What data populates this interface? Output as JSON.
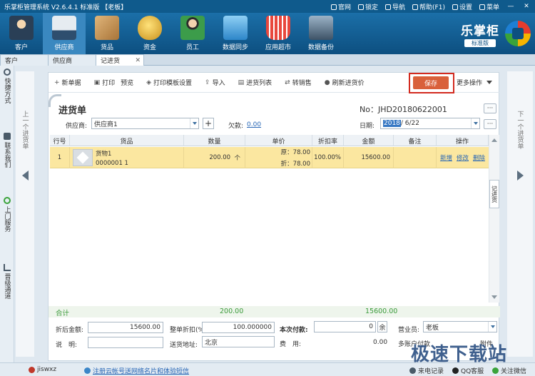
{
  "titlebar": {
    "title": "乐掌柜管理系统 V2.6.4.1 标准版 【老板】",
    "links": [
      "官网",
      "锁定",
      "导航",
      "帮助(F1)",
      "设置",
      "菜单"
    ],
    "window_buttons": [
      "—",
      "✕"
    ]
  },
  "toolbar": {
    "buttons": [
      {
        "label": "客户",
        "icon": "customer-icon",
        "color": "#e0a23a"
      },
      {
        "label": "供应商",
        "icon": "supplier-truck-icon",
        "color": "#c9d3dc"
      },
      {
        "label": "货品",
        "icon": "goods-box-icon",
        "color": "#c79a5a"
      },
      {
        "label": "资金",
        "icon": "money-bag-icon",
        "color": "#e2b23c"
      },
      {
        "label": "员工",
        "icon": "employee-icon",
        "color": "#3c9c4a"
      },
      {
        "label": "数据同步",
        "icon": "sync-icon",
        "color": "#58a7e0"
      },
      {
        "label": "应用超市",
        "icon": "app-market-icon",
        "color": "#d8423a"
      },
      {
        "label": "数据备份",
        "icon": "backup-icon",
        "color": "#6c7f92"
      }
    ],
    "brand_name": "乐掌柜",
    "brand_edition": "标准版"
  },
  "tabs": [
    {
      "label": "客户",
      "active": false
    },
    {
      "label": "供应商",
      "active": false
    },
    {
      "label": "记进货",
      "active": true,
      "close": "✕"
    }
  ],
  "left_sidebar": [
    {
      "label": "快捷方式",
      "icon": "quick-icon"
    },
    {
      "label": "联系我们",
      "icon": "phone-icon"
    },
    {
      "label": "上门服务",
      "icon": "bike-icon"
    },
    {
      "label": "晋级通道",
      "icon": "upgrade-icon"
    }
  ],
  "nav": {
    "prev": "上一个进货单",
    "next": "下一个进货单"
  },
  "actions": {
    "items": [
      "新单据",
      "打印",
      "预览",
      "打印模板设置",
      "导入",
      "进货列表",
      "转销售",
      "刷新进货价"
    ],
    "save": "保存",
    "more": "更多操作"
  },
  "doc": {
    "title": "进货单",
    "number": "No：JHD20180622001",
    "supplier_label": "供应商:",
    "supplier_value": "供应商1",
    "plus": "+",
    "owed_label": "欠款:",
    "owed_value": "0.00",
    "date_label": "日期:",
    "date_year": "2018",
    "date_rest": "/ 6/22",
    "more_dots": "···"
  },
  "grid": {
    "headers": [
      "行号",
      "货品",
      "数量",
      "单价",
      "折扣率",
      "金额",
      "备注",
      "操作"
    ],
    "rows": [
      {
        "no": "1",
        "goods_name": "货物1",
        "goods_code": "0000001 1",
        "qty": "200.00",
        "unit": "个",
        "price_orig": "原：78.00",
        "price_disc": "折：78.00",
        "discount": "100.00%",
        "amount": "15600.00",
        "remark": "",
        "ops": [
          "新增",
          "修改",
          "删除"
        ]
      }
    ],
    "side_handle": "记进货"
  },
  "totals": {
    "label": "合计",
    "qty": "200.00",
    "amount": "15600.00"
  },
  "form": {
    "after_disc_label": "折后金额:",
    "after_disc_value": "15600.00",
    "whole_disc_label": "整单折扣(%)",
    "whole_disc_value": "100.000000",
    "pay_label": "本次付款:",
    "pay_value": "0",
    "pay_suffix": "余",
    "seller_label": "营业员:",
    "seller_value": "老板",
    "note_label": "说　明:",
    "note_value": "",
    "address_label": "送货地址:",
    "address_value": "北京",
    "fee_label": "费　用:",
    "fee_value": "0.00",
    "multi_pay": "多账户付款",
    "attach": "附件"
  },
  "footer": {
    "user": "jiswxz",
    "register_link": "注册云帐号送网络名片和体验短信",
    "right": [
      "来电记录",
      "QQ客服",
      "关注微信"
    ]
  },
  "watermark": "极速下载站"
}
